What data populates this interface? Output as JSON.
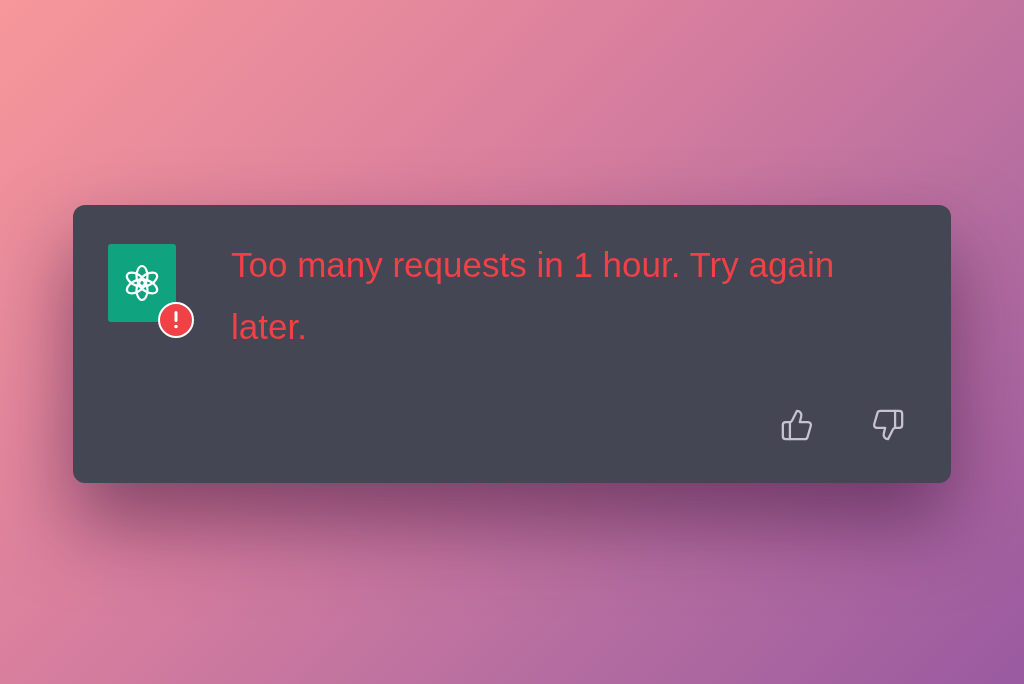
{
  "message": {
    "text": "Too many requests in 1 hour. Try again later.",
    "error": true
  },
  "actions": [
    {
      "kind": "thumbs-up"
    },
    {
      "kind": "thumbs-down"
    }
  ]
}
